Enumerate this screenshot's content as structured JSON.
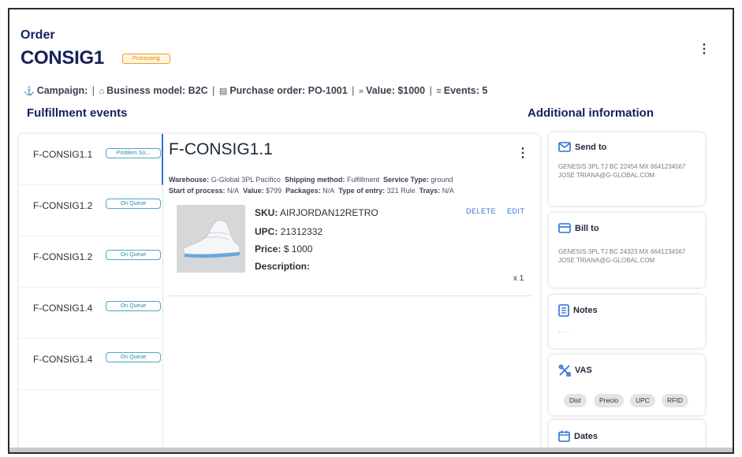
{
  "header": {
    "label": "Order",
    "order_id": "CONSIG1",
    "status": "Processing"
  },
  "meta": {
    "campaign": "Campaign:",
    "business_model": "Business model: B2C",
    "purchase_order": "Purchase order: PO-1001",
    "value": "Value: $1000",
    "events": "Events: 5",
    "separator": "|"
  },
  "sections": {
    "fulfillment_title": "Fulfillment events",
    "additional_title": "Additional information"
  },
  "events": [
    {
      "name": "F-CONSIG1.1",
      "status": "Problem So..."
    },
    {
      "name": "F-CONSIG1.2",
      "status": "On Queue"
    },
    {
      "name": "F-CONSIG1.2",
      "status": "On Queue"
    },
    {
      "name": "F-CONSIG1.4",
      "status": "On Queue"
    },
    {
      "name": "F-CONSIG1.4",
      "status": "On Queue"
    }
  ],
  "detail": {
    "title": "F-CONSIG1.1",
    "warehouse_label": "Warehouse:",
    "warehouse": "G-Global 3PL Pacifico",
    "shipping_label": "Shipping method:",
    "shipping": "Fulfillment",
    "service_label": "Service Type:",
    "service": "ground",
    "start_label": "Start of process:",
    "start": "N/A",
    "value_label": "Value:",
    "value": "$799",
    "packages_label": "Packages:",
    "packages": "N/A",
    "entry_label": "Type of entry:",
    "entry": "321 Rule",
    "trays_label": "Trays:",
    "trays": "N/A",
    "product": {
      "sku_label": "SKU:",
      "sku": "AIRJORDAN12RETRO",
      "upc_label": "UPC:",
      "upc": "21312332",
      "price_label": "Price:",
      "price": "$ 1000",
      "description_label": "Description:",
      "qty": "x 1"
    },
    "delete_label": "DELETE",
    "edit_label": "EDIT"
  },
  "cards": {
    "send_to": {
      "title": "Send to",
      "text": "GENESIS 3PL TJ BC 22454 MX 6641234567 JOSE TRIANA@G-GLOBAL.COM"
    },
    "bill_to": {
      "title": "Bill to",
      "text": "GENESIS 3PL TJ BC 24323 MX 6641234567 JOSE TRIANA@G-GLOBAL.COM"
    },
    "notes": {
      "title": "Notes",
      "text": "· · · ·"
    },
    "vas": {
      "title": "VAS",
      "chips": [
        "Dist",
        "Precio",
        "UPC",
        "RFID"
      ]
    },
    "dates": {
      "title": "Dates"
    }
  },
  "colors": {
    "brand": "#16215a",
    "accent": "#2f6fd8",
    "status_processing": "#f0a020",
    "status_queue": "#49a8c2"
  },
  "icons": [
    "share-icon",
    "business-icon",
    "document-icon",
    "value-icon",
    "list-icon",
    "mail-icon",
    "card-icon",
    "notes-icon",
    "tools-icon",
    "calendar-icon",
    "more-vert-icon"
  ]
}
